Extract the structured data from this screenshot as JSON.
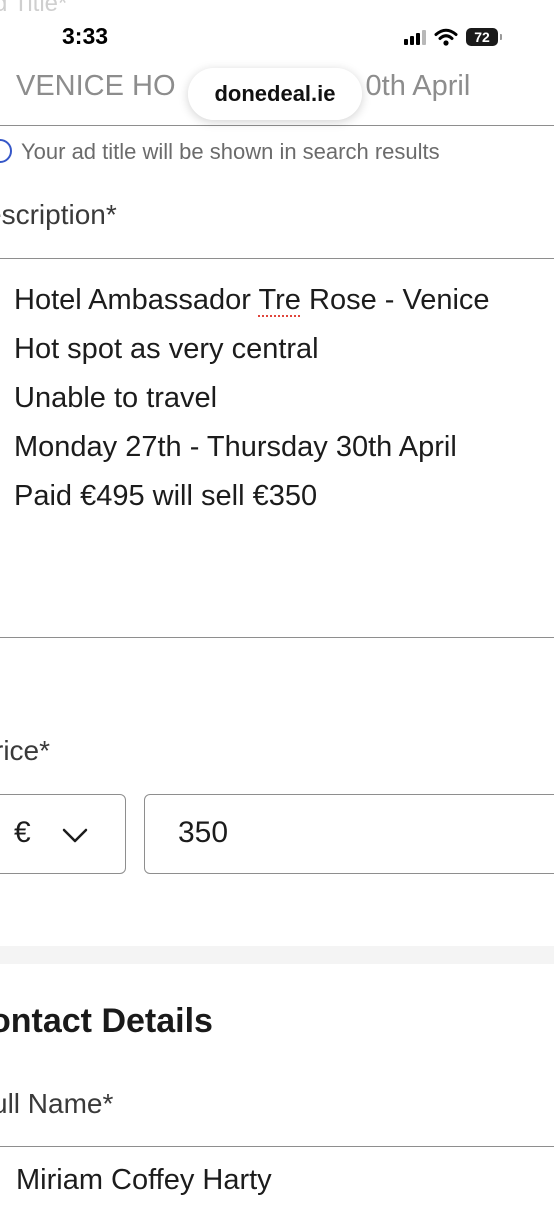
{
  "partial_label_top": "d Title*",
  "status_bar": {
    "time": "3:33",
    "battery": "72",
    "icons": [
      "cellular-signal-icon",
      "wifi-icon",
      "battery-icon"
    ]
  },
  "browser": {
    "url": "donedeal.ie"
  },
  "ad_title": {
    "value": "VENICE HOTEL DEAL 27th-30th April",
    "visible_left": "VENICE HO",
    "visible_right": "0th April"
  },
  "hint": {
    "icon": "info-circle-icon",
    "text": "Your ad title will be shown in search results"
  },
  "description": {
    "label": "escription*",
    "line1_before": "Hotel Ambassador ",
    "line1_spell": "Tre",
    "line1_after": " Rose - Venice",
    "line2": "Hot spot as very central",
    "line3": "Unable to travel",
    "line4": "Monday 27th - Thursday 30th April",
    "line5": "Paid €495 will sell €350"
  },
  "price": {
    "label": "rice*",
    "currency": "€",
    "amount": "350"
  },
  "contact": {
    "heading": "ontact Details",
    "name_label": "ull Name*",
    "name_value": "Miriam Coffey Harty"
  },
  "colors": {
    "hint_icon": "#3557c8",
    "border": "#8e8e8e",
    "spellcheck": "#e0463c"
  }
}
